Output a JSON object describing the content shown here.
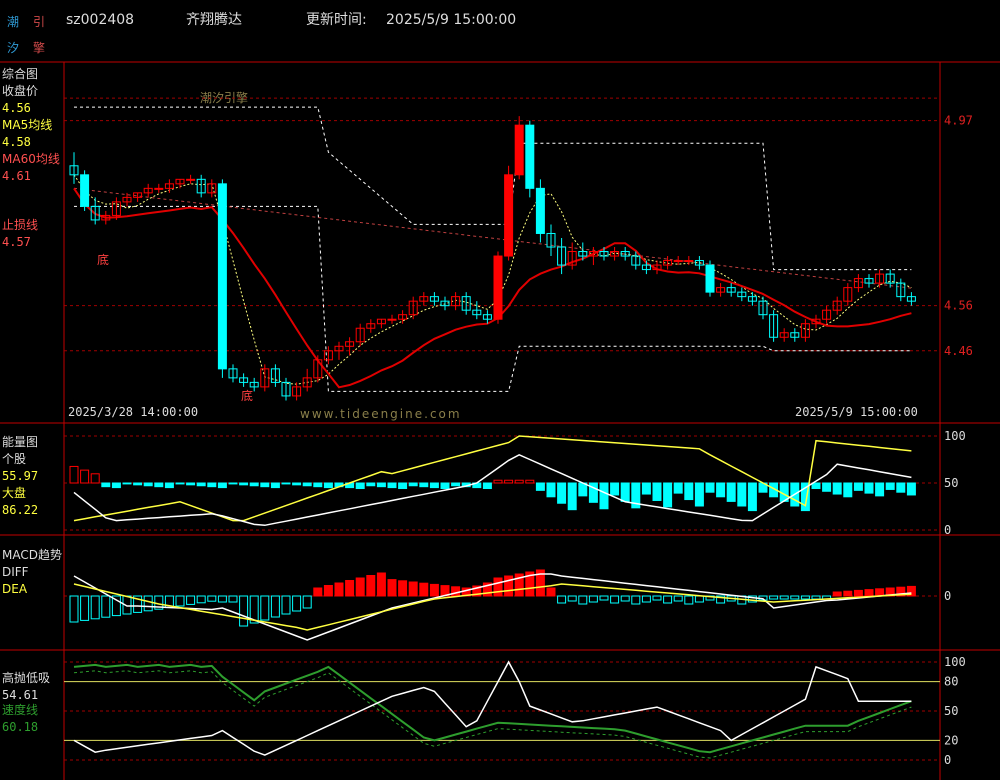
{
  "header": {
    "logo_chars": [
      "潮",
      "引",
      "汐",
      "擎"
    ],
    "code": "sz002408",
    "name": "齐翔腾达",
    "update_label": "更新时间:",
    "update_time": "2025/5/9 15:00:00"
  },
  "watermarks": {
    "cn": "潮汐引擎",
    "url": "www.tideengine.com"
  },
  "colors": {
    "up": "#ff0000",
    "down": "#00ffff",
    "ma5": "#ffffff",
    "ma60": "#e00000",
    "frame": "#c00000",
    "yellow": "#ffff40",
    "green": "#2e9e2e"
  },
  "panel_main": {
    "title": "综合图",
    "close_label": "收盘价",
    "close_value": "4.56",
    "ma5_label": "MA5均线",
    "ma5_value": "4.58",
    "ma60_label": "MA60均线",
    "ma60_value": "4.61",
    "stop_label": "止损线",
    "stop_value": "4.57",
    "bottom_marks": [
      "底",
      "底"
    ],
    "date_start": "2025/3/28 14:00:00",
    "date_end": "2025/5/9 15:00:00",
    "price_ticks": [
      "4.97",
      "4.56",
      "4.46"
    ]
  },
  "panel_energy": {
    "title": "能量图",
    "stock_label": "个股",
    "stock_value": "55.97",
    "market_label": "大盘",
    "market_value": "86.22",
    "ticks": [
      "100",
      "50",
      "0"
    ]
  },
  "panel_macd": {
    "title": "MACD趋势",
    "diff_label": "DIFF",
    "dea_label": "DEA",
    "ticks": [
      "0"
    ]
  },
  "panel_osc": {
    "title": "高抛低吸",
    "value": "54.61",
    "speed_label": "速度线",
    "speed_value": "60.18",
    "ticks": [
      "100",
      "80",
      "50",
      "20",
      "0"
    ]
  },
  "chart_data": {
    "type": "candlestick",
    "candles": [
      [
        4.87,
        4.9,
        4.83,
        4.85
      ],
      [
        4.85,
        4.86,
        4.77,
        4.78
      ],
      [
        4.78,
        4.8,
        4.74,
        4.75
      ],
      [
        4.75,
        4.77,
        4.74,
        4.76
      ],
      [
        4.76,
        4.8,
        4.75,
        4.79
      ],
      [
        4.79,
        4.81,
        4.78,
        4.8
      ],
      [
        4.8,
        4.81,
        4.79,
        4.81
      ],
      [
        4.81,
        4.83,
        4.8,
        4.82
      ],
      [
        4.82,
        4.83,
        4.81,
        4.82
      ],
      [
        4.82,
        4.84,
        4.81,
        4.83
      ],
      [
        4.83,
        4.84,
        4.82,
        4.84
      ],
      [
        4.84,
        4.85,
        4.83,
        4.84
      ],
      [
        4.84,
        4.85,
        4.8,
        4.81
      ],
      [
        4.81,
        4.84,
        4.8,
        4.83
      ],
      [
        4.83,
        4.84,
        4.4,
        4.42
      ],
      [
        4.42,
        4.43,
        4.39,
        4.4
      ],
      [
        4.4,
        4.41,
        4.38,
        4.39
      ],
      [
        4.39,
        4.4,
        4.37,
        4.38
      ],
      [
        4.38,
        4.43,
        4.37,
        4.42
      ],
      [
        4.42,
        4.43,
        4.38,
        4.39
      ],
      [
        4.39,
        4.4,
        4.35,
        4.36
      ],
      [
        4.36,
        4.39,
        4.35,
        4.38
      ],
      [
        4.38,
        4.42,
        4.37,
        4.4
      ],
      [
        4.4,
        4.45,
        4.39,
        4.44
      ],
      [
        4.44,
        4.47,
        4.43,
        4.46
      ],
      [
        4.46,
        4.48,
        4.44,
        4.47
      ],
      [
        4.47,
        4.49,
        4.45,
        4.48
      ],
      [
        4.48,
        4.52,
        4.47,
        4.51
      ],
      [
        4.51,
        4.53,
        4.5,
        4.52
      ],
      [
        4.52,
        4.53,
        4.51,
        4.53
      ],
      [
        4.53,
        4.54,
        4.52,
        4.53
      ],
      [
        4.53,
        4.55,
        4.52,
        4.54
      ],
      [
        4.54,
        4.58,
        4.53,
        4.57
      ],
      [
        4.57,
        4.59,
        4.56,
        4.58
      ],
      [
        4.58,
        4.59,
        4.56,
        4.57
      ],
      [
        4.57,
        4.58,
        4.55,
        4.56
      ],
      [
        4.56,
        4.59,
        4.55,
        4.58
      ],
      [
        4.58,
        4.59,
        4.54,
        4.55
      ],
      [
        4.55,
        4.57,
        4.53,
        4.54
      ],
      [
        4.54,
        4.55,
        4.52,
        4.53
      ],
      [
        4.53,
        4.68,
        4.52,
        4.67
      ],
      [
        4.67,
        4.87,
        4.66,
        4.85
      ],
      [
        4.85,
        4.98,
        4.84,
        4.96
      ],
      [
        4.96,
        4.97,
        4.8,
        4.82
      ],
      [
        4.82,
        4.84,
        4.7,
        4.72
      ],
      [
        4.72,
        4.74,
        4.67,
        4.69
      ],
      [
        4.69,
        4.71,
        4.63,
        4.65
      ],
      [
        4.65,
        4.7,
        4.64,
        4.68
      ],
      [
        4.68,
        4.7,
        4.66,
        4.67
      ],
      [
        4.67,
        4.69,
        4.65,
        4.68
      ],
      [
        4.68,
        4.69,
        4.66,
        4.67
      ],
      [
        4.67,
        4.69,
        4.66,
        4.68
      ],
      [
        4.68,
        4.69,
        4.66,
        4.67
      ],
      [
        4.67,
        4.68,
        4.64,
        4.65
      ],
      [
        4.65,
        4.66,
        4.63,
        4.64
      ],
      [
        4.64,
        4.66,
        4.63,
        4.65
      ],
      [
        4.65,
        4.67,
        4.64,
        4.66
      ],
      [
        4.66,
        4.67,
        4.65,
        4.66
      ],
      [
        4.66,
        4.67,
        4.65,
        4.66
      ],
      [
        4.66,
        4.67,
        4.64,
        4.65
      ],
      [
        4.65,
        4.66,
        4.58,
        4.59
      ],
      [
        4.59,
        4.61,
        4.58,
        4.6
      ],
      [
        4.6,
        4.61,
        4.58,
        4.59
      ],
      [
        4.59,
        4.6,
        4.57,
        4.58
      ],
      [
        4.58,
        4.59,
        4.56,
        4.57
      ],
      [
        4.57,
        4.58,
        4.53,
        4.54
      ],
      [
        4.54,
        4.55,
        4.48,
        4.49
      ],
      [
        4.49,
        4.51,
        4.48,
        4.5
      ],
      [
        4.5,
        4.51,
        4.48,
        4.49
      ],
      [
        4.49,
        4.53,
        4.48,
        4.52
      ],
      [
        4.52,
        4.54,
        4.51,
        4.53
      ],
      [
        4.53,
        4.56,
        4.52,
        4.55
      ],
      [
        4.55,
        4.58,
        4.54,
        4.57
      ],
      [
        4.57,
        4.61,
        4.56,
        4.6
      ],
      [
        4.6,
        4.63,
        4.59,
        4.62
      ],
      [
        4.62,
        4.63,
        4.6,
        4.61
      ],
      [
        4.61,
        4.64,
        4.6,
        4.63
      ],
      [
        4.63,
        4.64,
        4.6,
        4.61
      ],
      [
        4.61,
        4.62,
        4.57,
        4.58
      ],
      [
        4.58,
        4.59,
        4.56,
        4.57
      ]
    ]
  }
}
